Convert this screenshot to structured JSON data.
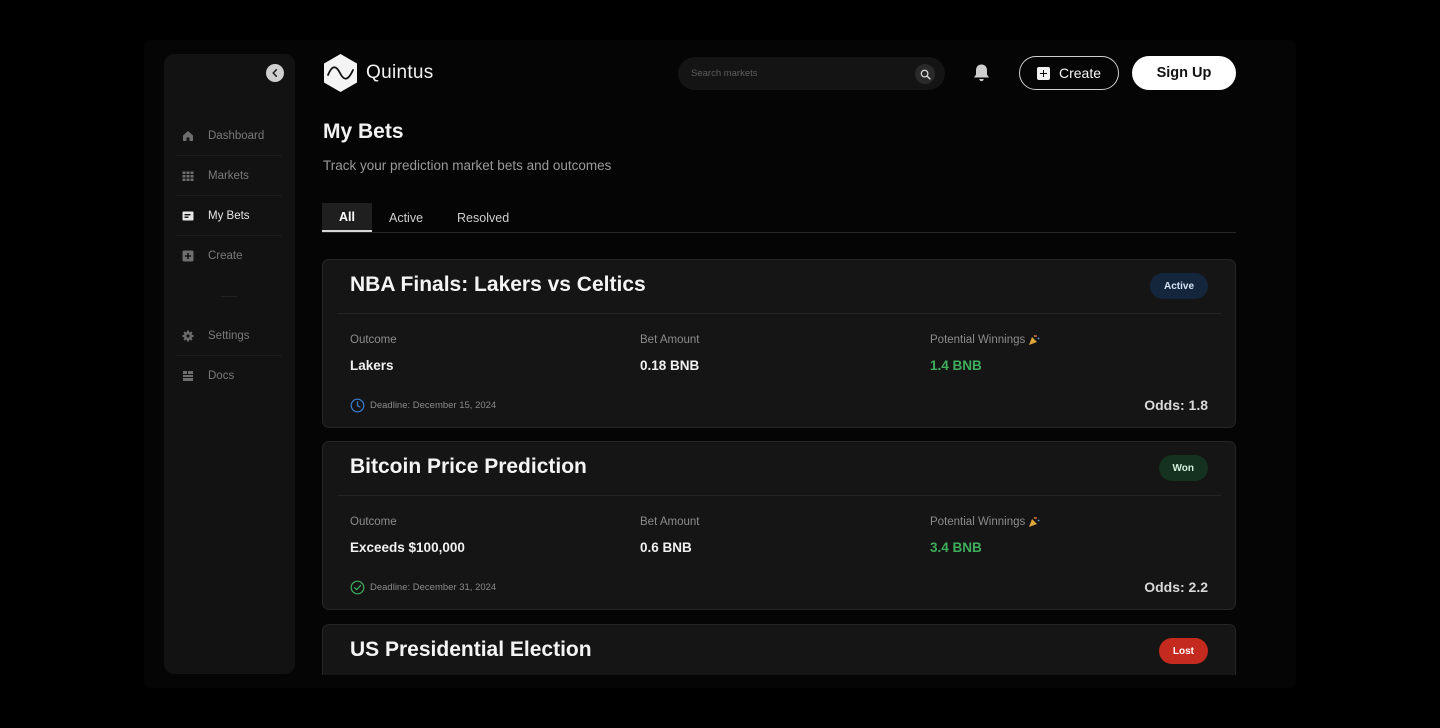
{
  "app": {
    "name": "Quintus"
  },
  "sidebar": {
    "items": [
      {
        "label": "Dashboard",
        "icon": "home-icon",
        "active": false
      },
      {
        "label": "Markets",
        "icon": "grid-icon",
        "active": false
      },
      {
        "label": "My Bets",
        "icon": "ticket-icon",
        "active": true
      },
      {
        "label": "Create",
        "icon": "plus-square-icon",
        "active": false
      }
    ],
    "bottom_items": [
      {
        "label": "Settings",
        "icon": "gear-icon"
      },
      {
        "label": "Docs",
        "icon": "docs-icon"
      }
    ]
  },
  "header": {
    "search_placeholder": "Search markets",
    "create_label": "Create",
    "signup_label": "Sign Up"
  },
  "page": {
    "title": "My Bets",
    "subtitle": "Track your prediction market bets and outcomes",
    "tabs": [
      {
        "label": "All",
        "active": true
      },
      {
        "label": "Active",
        "active": false
      },
      {
        "label": "Resolved",
        "active": false
      }
    ]
  },
  "labels": {
    "outcome": "Outcome",
    "bet_amount": "Bet Amount",
    "potential_winnings": "Potential Winnings"
  },
  "bets": [
    {
      "title": "NBA Finals: Lakers vs Celtics",
      "status": "Active",
      "outcome": "Lakers",
      "bet_amount": "0.18 BNB",
      "potential_winnings": "1.4 BNB",
      "deadline": "Deadline: December 15, 2024",
      "odds": "Odds: 1.8"
    },
    {
      "title": "Bitcoin Price Prediction",
      "status": "Won",
      "outcome": "Exceeds $100,000",
      "bet_amount": "0.6 BNB",
      "potential_winnings": "3.4 BNB",
      "deadline": "Deadline: December 31, 2024",
      "odds": "Odds: 2.2"
    },
    {
      "title": "US Presidential Election",
      "status": "Lost"
    }
  ],
  "colors": {
    "background": "#000000",
    "card": "#151515",
    "winnings_green": "#3fae5c",
    "badge_active": "#13263c",
    "badge_won": "#153220",
    "badge_lost": "#c42a1e",
    "deadline_clock": "#3b7fd4",
    "deadline_check": "#3fae5c"
  }
}
